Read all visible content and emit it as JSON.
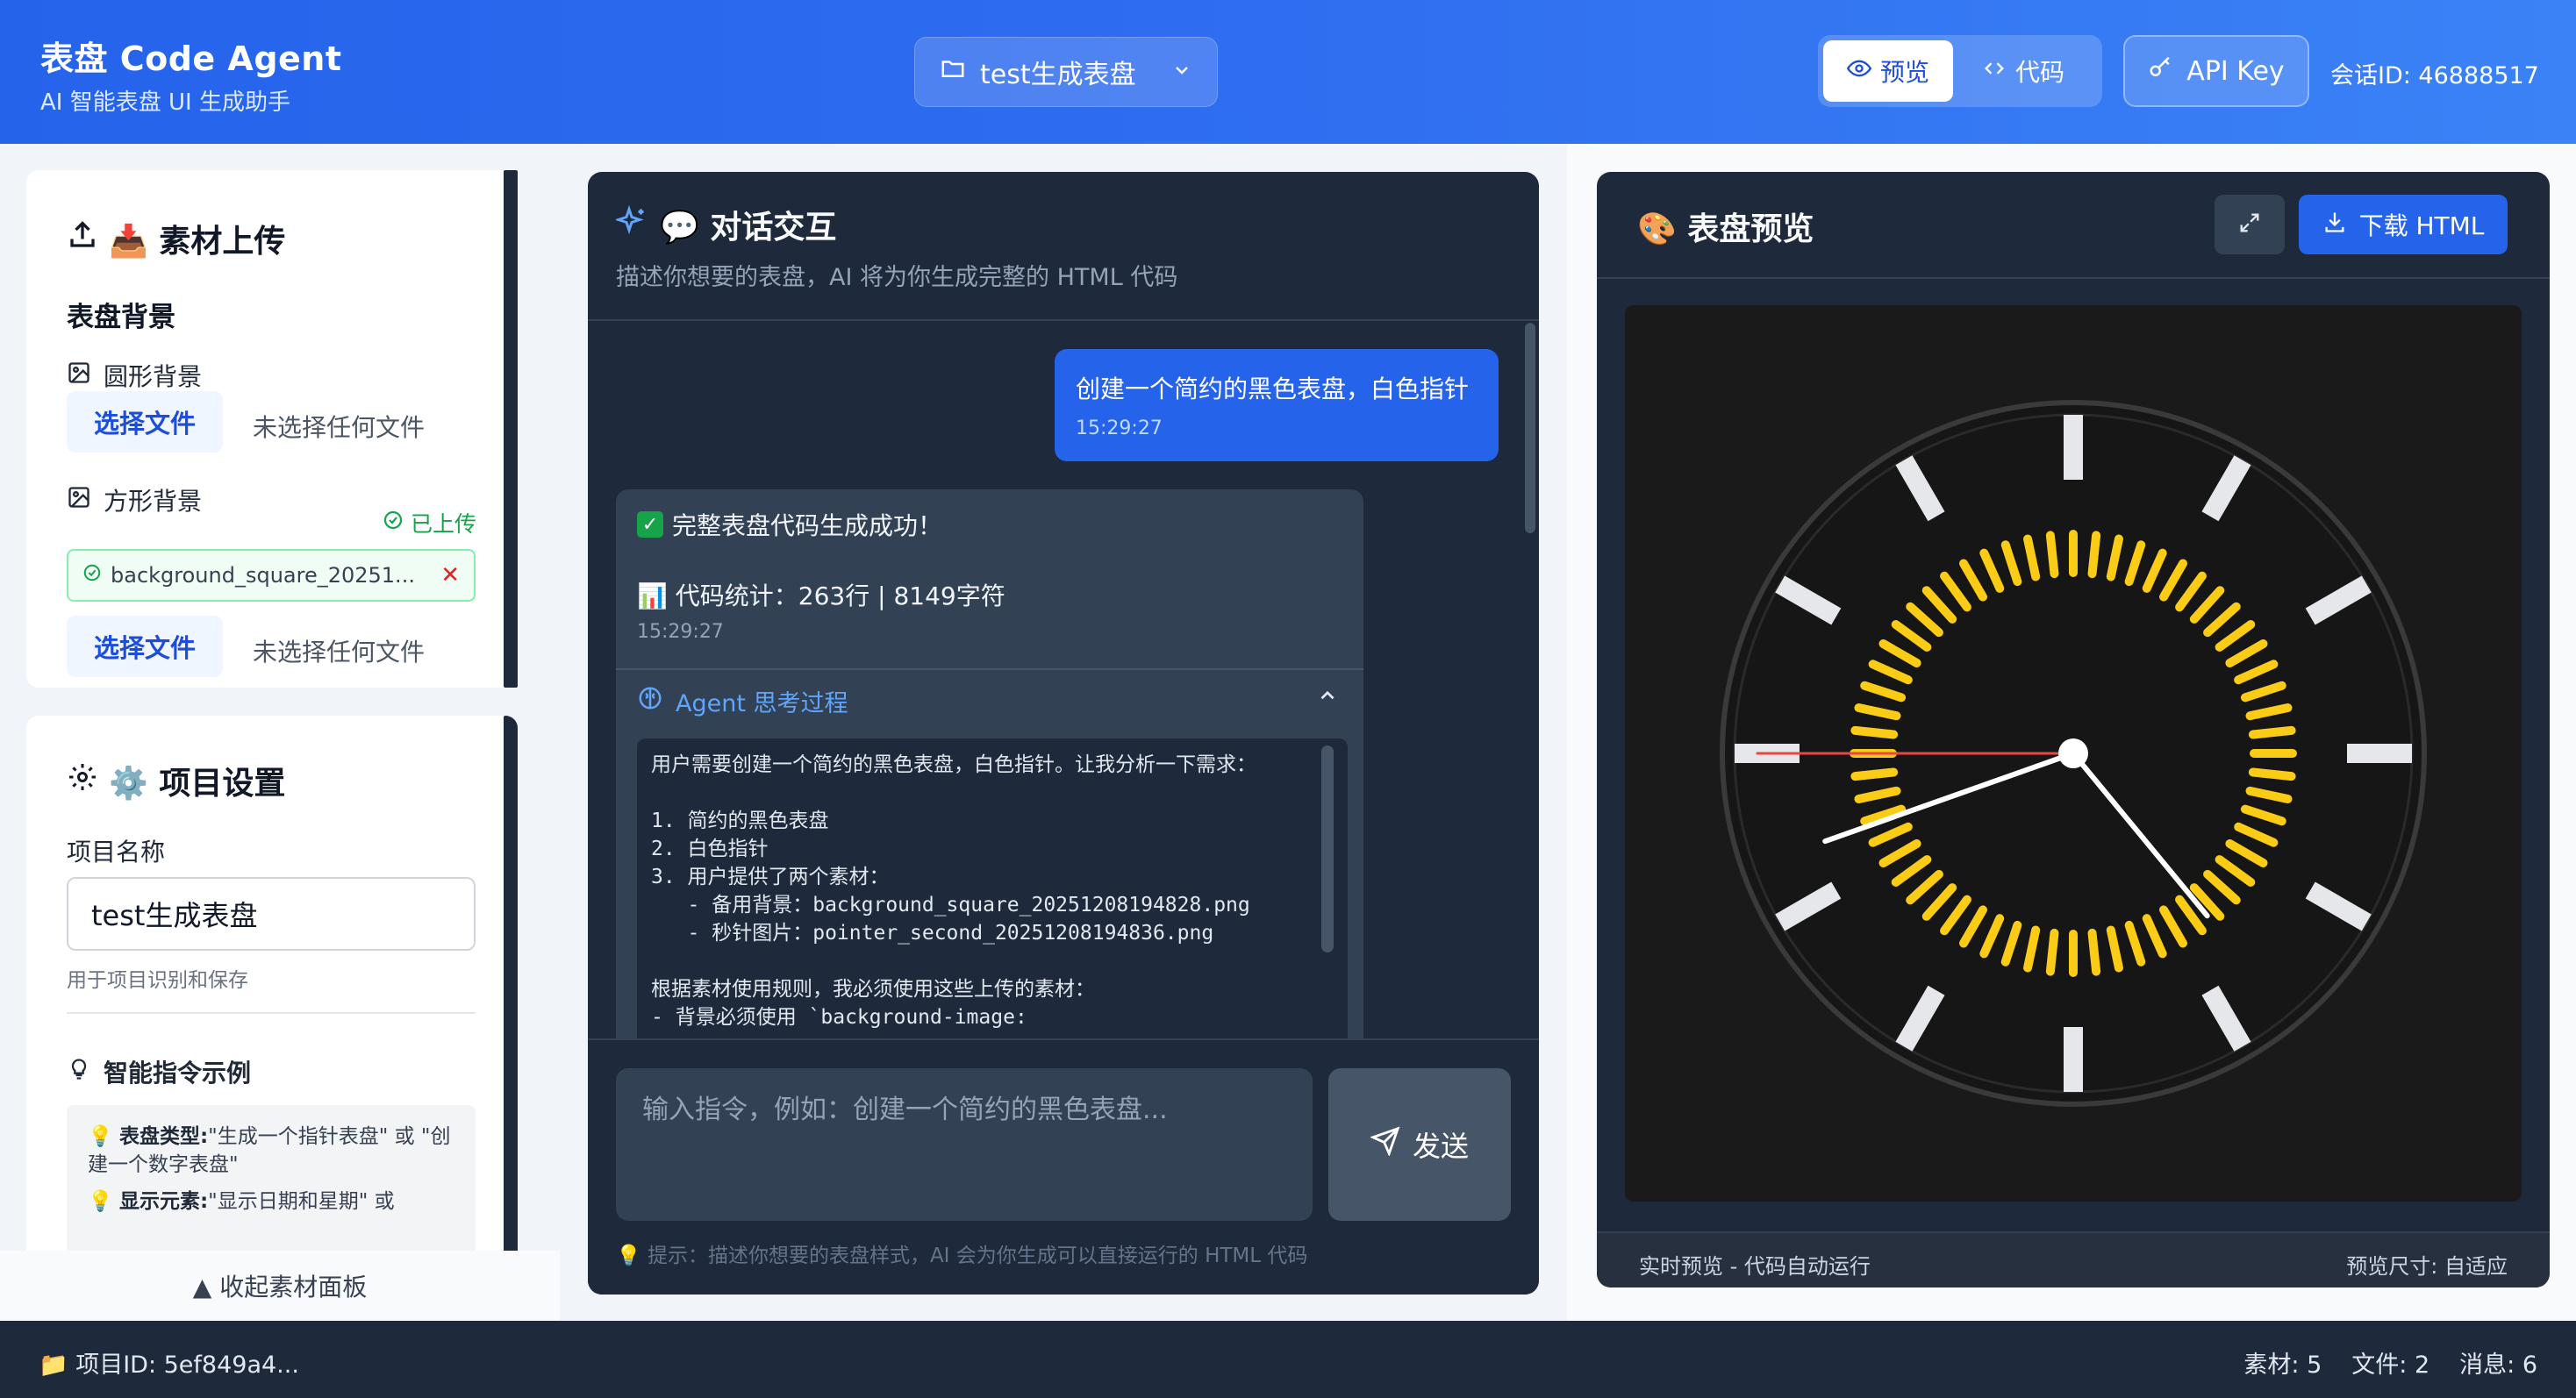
{
  "header": {
    "app_title": "表盘 Code Agent",
    "app_subtitle": "AI 智能表盘 UI 生成助手",
    "project_select": "test生成表盘",
    "view_preview": "预览",
    "view_code": "代码",
    "api_key_label": "API Key",
    "session_id": "会话ID: 46888517"
  },
  "upload": {
    "title": "📥 素材上传",
    "section_label": "表盘背景",
    "round_bg_label": "圆形背景",
    "square_bg_label": "方形背景",
    "uploaded_tag": "已上传",
    "uploaded_file_name": "background_square_20251...",
    "choose_file": "选择文件",
    "no_file": "未选择任何文件"
  },
  "settings": {
    "title": "⚙️ 项目设置",
    "project_name_label": "项目名称",
    "project_name_value": "test生成表盘",
    "project_name_help": "用于项目识别和保存",
    "tips_title": "智能指令示例",
    "tips": [
      {
        "key": "表盘类型:",
        "text": "\"生成一个指针表盘\" 或 \"创建一个数字表盘\""
      },
      {
        "key": "显示元素:",
        "text": "\"显示日期和星期\" 或"
      }
    ],
    "collapse_label": "▲ 收起素材面板"
  },
  "chat": {
    "title": "💬 对话交互",
    "subtitle": "描述你想要的表盘，AI 将为你生成完整的 HTML 代码",
    "user_message": "创建一个简约的黑色表盘，白色指针",
    "user_time": "15:29:27",
    "success_text": "完整表盘代码生成成功！",
    "stats_text": "📊 代码统计：263行 | 8149字符",
    "assistant_time": "15:29:27",
    "thinking_title": "Agent 思考过程",
    "thinking_lines": [
      "用户需要创建一个简约的黑色表盘，白色指针。让我分析一下需求：",
      "",
      "1. 简约的黑色表盘",
      "2. 白色指针",
      "3. 用户提供了两个素材：",
      "   - 备用背景：background_square_20251208194828.png",
      "   - 秒针图片：pointer_second_20251208194836.png",
      "",
      "根据素材使用规则，我必须使用这些上传的素材：",
      "- 背景必须使用 `background-image:"
    ],
    "input_placeholder": "输入指令，例如：创建一个简约的黑色表盘...",
    "send_label": "发送",
    "hint": "💡 提示：描述你想要的表盘样式，AI 会为你生成可以直接运行的 HTML 代码"
  },
  "preview": {
    "title": "🎨 表盘预览",
    "download_label": "下载 HTML",
    "status": "实时预览 - 代码自动运行",
    "size": "预览尺寸: 自适应",
    "watch": {
      "accent_color": "#facc15",
      "second_hand_color": "#ef4444",
      "hand_color": "#ffffff",
      "tick_color": "#e5e7eb",
      "time": {
        "hour": 4,
        "minute": 41,
        "second": 45
      }
    }
  },
  "status_bar": {
    "project_id": "📁 项目ID: 5ef849a4...",
    "assets": "素材: 5",
    "files": "文件: 2",
    "messages": "消息: 6"
  }
}
